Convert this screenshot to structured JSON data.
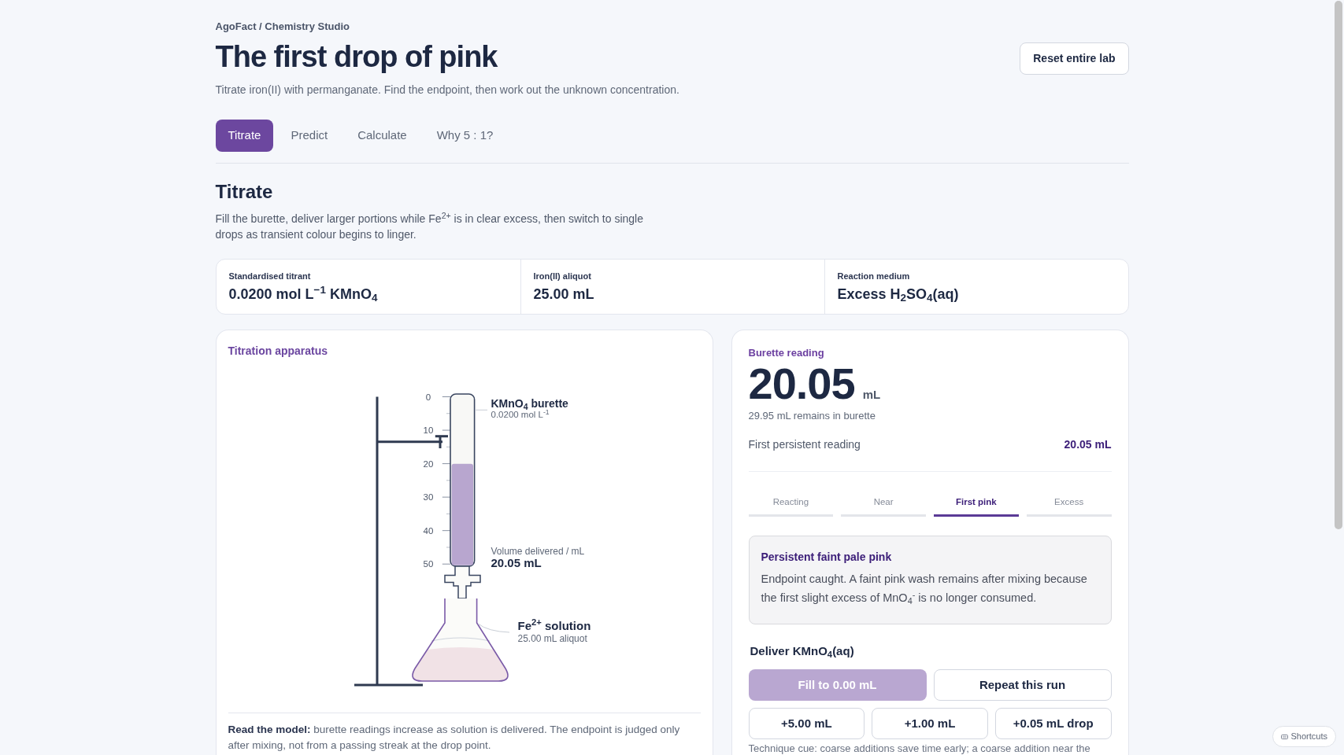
{
  "header": {
    "breadcrumb": "AgoFact / Chemistry Studio",
    "title": "The first drop of pink",
    "subtitle": "Titrate iron(II) with permanganate. Find the endpoint, then work out the unknown concentration.",
    "reset_button": "Reset entire lab"
  },
  "tabs": [
    {
      "label": "Titrate",
      "selected": true
    },
    {
      "label": "Predict",
      "selected": false
    },
    {
      "label": "Calculate",
      "selected": false
    },
    {
      "label": "Why 5 : 1?",
      "selected": false
    }
  ],
  "section": {
    "title": "Titrate",
    "intro": "Fill the burette, deliver larger portions while Fe$^{2+}$ is in clear excess, then switch to single drops as transient colour begins to linger."
  },
  "conditions": [
    {
      "label": "Standardised titrant",
      "value": "0.0200 mol L$^{−1}$ KMnO$_{4}$"
    },
    {
      "label": "Iron(II) aliquot",
      "value": "25.00 mL"
    },
    {
      "label": "Reaction medium",
      "value": "Excess H$_{2}$SO$_{4}$(aq)"
    }
  ],
  "apparatus": {
    "title": "Titration apparatus",
    "scale_labels": [
      "0",
      "10",
      "20",
      "30",
      "40",
      "50"
    ],
    "burette": {
      "name": "KMnO$_{4}$ burette",
      "concentration": "0.0200 mol L$^{-1}$",
      "level": 0.599
    },
    "delivered": {
      "label": "Volume delivered / mL",
      "value": "20.05 mL"
    },
    "flask": {
      "name": "Fe$^{2+}$ solution",
      "volume": "25.00 mL aliquot"
    },
    "note": "**Read the model:** burette readings increase as solution is delivered. The endpoint is judged only after mixing, not from a passing streak at the drop point."
  },
  "reading": {
    "label": "Burette reading",
    "value": "20.05",
    "unit": "mL",
    "remaining": "29.95 mL remains in burette",
    "persistent_label": "First persistent reading",
    "persistent_value": "20.05 mL"
  },
  "stages": [
    {
      "label": "Reacting",
      "selected": false
    },
    {
      "label": "Near",
      "selected": false
    },
    {
      "label": "First pink",
      "selected": true
    },
    {
      "label": "Excess",
      "selected": false
    }
  ],
  "observation": {
    "title": "Persistent faint pale pink",
    "text": "Endpoint caught. A faint pink wash remains after mixing because the first slight excess of MnO$_{4}$$^{-}$ is no longer consumed."
  },
  "deliver": {
    "title": "Deliver KMnO$_{4}$(aq)",
    "buttons": [
      {
        "label": "Fill to 0.00 mL",
        "kind": "primary",
        "disabled": true
      },
      {
        "label": "Repeat this run",
        "kind": "secondary",
        "disabled": false
      }
    ],
    "additions": [
      "+5.00 mL",
      "+1.00 mL",
      "+0.05 mL drop"
    ],
    "cue": "Technique cue: coarse additions save time early; a coarse addition near the"
  },
  "shortcuts_button": "Shortcuts"
}
